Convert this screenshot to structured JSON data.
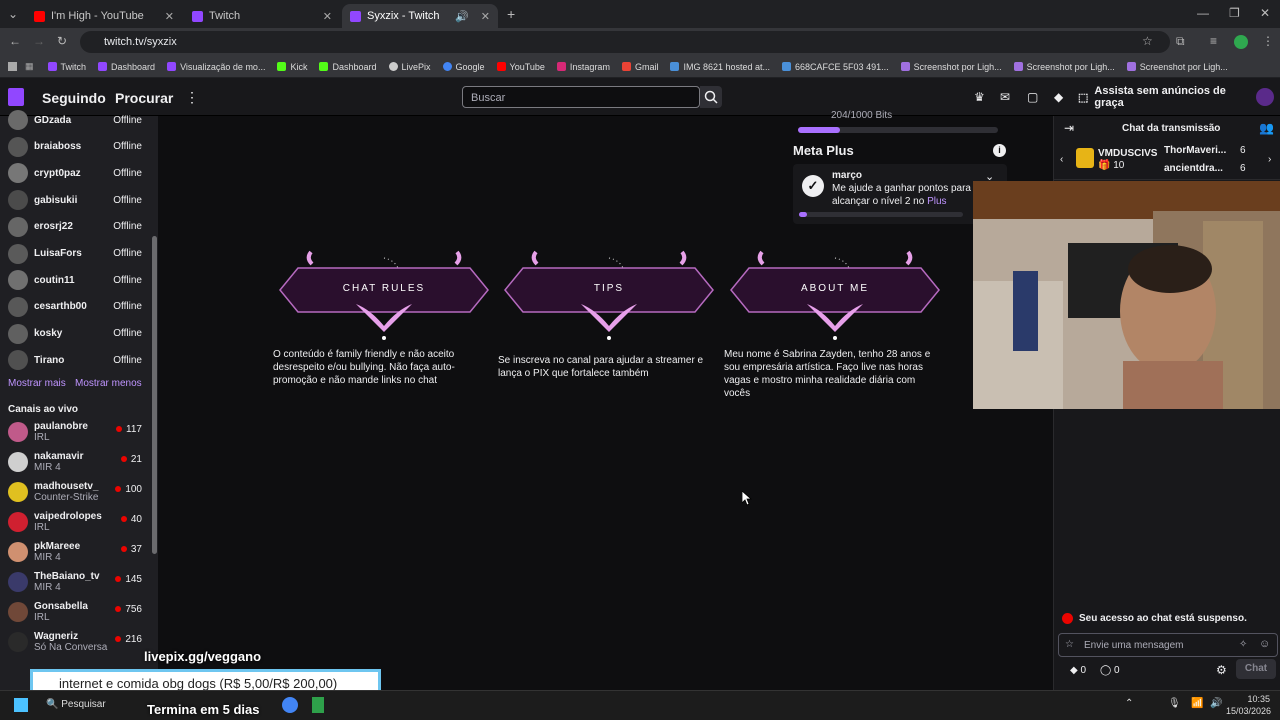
{
  "browser": {
    "tabs": [
      {
        "title": "I'm High - YouTube"
      },
      {
        "title": "Twitch"
      },
      {
        "title": "Syxzix - Twitch"
      }
    ],
    "url": "twitch.tv/syxzix",
    "bookmarks": [
      "Twitch",
      "Dashboard",
      "Visualização de mo...",
      "Kick",
      "Dashboard",
      "LivePix",
      "Google",
      "YouTube",
      "Instagram",
      "Gmail",
      "IMG 8621 hosted at...",
      "668CAFCE 5F03 491...",
      "Screenshot por Ligh...",
      "Screenshot por Ligh...",
      "Screenshot por Ligh..."
    ]
  },
  "topnav": {
    "following": "Seguindo",
    "browse": "Procurar",
    "search_placeholder": "Buscar",
    "adfree": "Assista sem anúncios de graça"
  },
  "sidebar": {
    "followed": [
      {
        "name": "GDzada",
        "status": "Offline"
      },
      {
        "name": "braiaboss",
        "status": "Offline"
      },
      {
        "name": "crypt0paz",
        "status": "Offline"
      },
      {
        "name": "gabisukii",
        "status": "Offline"
      },
      {
        "name": "erosrj22",
        "status": "Offline"
      },
      {
        "name": "LuisaFors",
        "status": "Offline"
      },
      {
        "name": "coutin11",
        "status": "Offline"
      },
      {
        "name": "cesarthb00",
        "status": "Offline"
      },
      {
        "name": "kosky",
        "status": "Offline"
      },
      {
        "name": "Tirano",
        "status": "Offline"
      }
    ],
    "show_more": "Mostrar mais",
    "show_less": "Mostrar menos",
    "live_header": "Canais ao vivo",
    "live": [
      {
        "name": "paulanobre",
        "game": "IRL",
        "viewers": "117"
      },
      {
        "name": "nakamavir",
        "game": "MIR 4",
        "viewers": "21"
      },
      {
        "name": "madhousetv_",
        "game": "Counter-Strike",
        "viewers": "100"
      },
      {
        "name": "vaipedrolopes",
        "game": "IRL",
        "viewers": "40"
      },
      {
        "name": "pkMareee",
        "game": "MIR 4",
        "viewers": "37"
      },
      {
        "name": "TheBaiano_tv",
        "game": "MIR 4",
        "viewers": "145"
      },
      {
        "name": "Gonsabella",
        "game": "IRL",
        "viewers": "756"
      },
      {
        "name": "Wagneriz",
        "game": "Só Na Conversa",
        "viewers": "216"
      }
    ]
  },
  "meta": {
    "bits": "204/1000 Bits",
    "title": "Meta Plus",
    "month": "março",
    "desc": "Me ajude a ganhar pontos para alcançar o nível 2 no",
    "plus": "Plus",
    "progress": 0.05
  },
  "panels": [
    {
      "title": "CHAT RULES",
      "text": "O conteúdo é family friendly e não aceito desrespeito e/ou bullying. Não faça auto-promoção e não mande links no chat"
    },
    {
      "title": "TIPS",
      "text": "Se inscreva no canal para ajudar a streamer e lança o PIX que fortalece também"
    },
    {
      "title": "ABOUT ME",
      "text": "Meu nome é Sabrina Zayden, tenho 28 anos e sou empresária artística. Faço live nas horas vagas e mostro minha realidade diária com vocês"
    }
  ],
  "chat": {
    "title": "Chat da transmissão",
    "gifter": {
      "name": "VMDUSCIVS",
      "count": "10"
    },
    "leaders": [
      {
        "name": "ThorMaveri...",
        "count": "6"
      },
      {
        "name": "ancientdra...",
        "count": "6"
      }
    ],
    "suspended": "Seu acesso ao chat está suspenso.",
    "placeholder": "Envie uma mensagem",
    "points1": "0",
    "points2": "0",
    "chat_btn": "Chat"
  },
  "overlay": {
    "pix": "livepix.gg/veggano",
    "banner": "internet e comida obg dogs (R$ 5,00/R$ 200,00)",
    "ends": "Termina em 5 dias"
  },
  "taskbar": {
    "search": "Pesquisar",
    "time": "10:35",
    "date": "15/03/2026"
  }
}
